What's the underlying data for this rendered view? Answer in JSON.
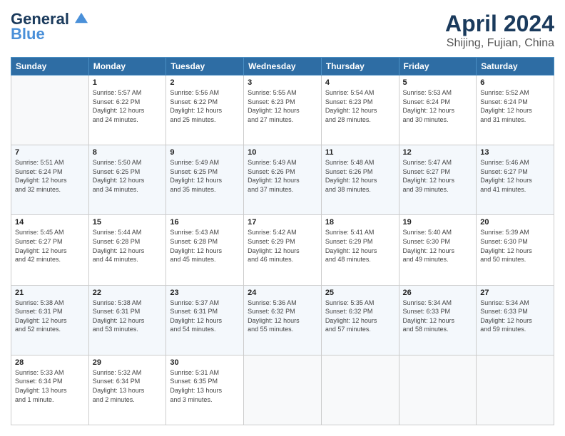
{
  "header": {
    "logo_line1": "General",
    "logo_line2": "Blue",
    "month": "April 2024",
    "location": "Shijing, Fujian, China"
  },
  "weekdays": [
    "Sunday",
    "Monday",
    "Tuesday",
    "Wednesday",
    "Thursday",
    "Friday",
    "Saturday"
  ],
  "weeks": [
    [
      {
        "day": "",
        "info": ""
      },
      {
        "day": "1",
        "info": "Sunrise: 5:57 AM\nSunset: 6:22 PM\nDaylight: 12 hours\nand 24 minutes."
      },
      {
        "day": "2",
        "info": "Sunrise: 5:56 AM\nSunset: 6:22 PM\nDaylight: 12 hours\nand 25 minutes."
      },
      {
        "day": "3",
        "info": "Sunrise: 5:55 AM\nSunset: 6:23 PM\nDaylight: 12 hours\nand 27 minutes."
      },
      {
        "day": "4",
        "info": "Sunrise: 5:54 AM\nSunset: 6:23 PM\nDaylight: 12 hours\nand 28 minutes."
      },
      {
        "day": "5",
        "info": "Sunrise: 5:53 AM\nSunset: 6:24 PM\nDaylight: 12 hours\nand 30 minutes."
      },
      {
        "day": "6",
        "info": "Sunrise: 5:52 AM\nSunset: 6:24 PM\nDaylight: 12 hours\nand 31 minutes."
      }
    ],
    [
      {
        "day": "7",
        "info": "Sunrise: 5:51 AM\nSunset: 6:24 PM\nDaylight: 12 hours\nand 32 minutes."
      },
      {
        "day": "8",
        "info": "Sunrise: 5:50 AM\nSunset: 6:25 PM\nDaylight: 12 hours\nand 34 minutes."
      },
      {
        "day": "9",
        "info": "Sunrise: 5:49 AM\nSunset: 6:25 PM\nDaylight: 12 hours\nand 35 minutes."
      },
      {
        "day": "10",
        "info": "Sunrise: 5:49 AM\nSunset: 6:26 PM\nDaylight: 12 hours\nand 37 minutes."
      },
      {
        "day": "11",
        "info": "Sunrise: 5:48 AM\nSunset: 6:26 PM\nDaylight: 12 hours\nand 38 minutes."
      },
      {
        "day": "12",
        "info": "Sunrise: 5:47 AM\nSunset: 6:27 PM\nDaylight: 12 hours\nand 39 minutes."
      },
      {
        "day": "13",
        "info": "Sunrise: 5:46 AM\nSunset: 6:27 PM\nDaylight: 12 hours\nand 41 minutes."
      }
    ],
    [
      {
        "day": "14",
        "info": "Sunrise: 5:45 AM\nSunset: 6:27 PM\nDaylight: 12 hours\nand 42 minutes."
      },
      {
        "day": "15",
        "info": "Sunrise: 5:44 AM\nSunset: 6:28 PM\nDaylight: 12 hours\nand 44 minutes."
      },
      {
        "day": "16",
        "info": "Sunrise: 5:43 AM\nSunset: 6:28 PM\nDaylight: 12 hours\nand 45 minutes."
      },
      {
        "day": "17",
        "info": "Sunrise: 5:42 AM\nSunset: 6:29 PM\nDaylight: 12 hours\nand 46 minutes."
      },
      {
        "day": "18",
        "info": "Sunrise: 5:41 AM\nSunset: 6:29 PM\nDaylight: 12 hours\nand 48 minutes."
      },
      {
        "day": "19",
        "info": "Sunrise: 5:40 AM\nSunset: 6:30 PM\nDaylight: 12 hours\nand 49 minutes."
      },
      {
        "day": "20",
        "info": "Sunrise: 5:39 AM\nSunset: 6:30 PM\nDaylight: 12 hours\nand 50 minutes."
      }
    ],
    [
      {
        "day": "21",
        "info": "Sunrise: 5:38 AM\nSunset: 6:31 PM\nDaylight: 12 hours\nand 52 minutes."
      },
      {
        "day": "22",
        "info": "Sunrise: 5:38 AM\nSunset: 6:31 PM\nDaylight: 12 hours\nand 53 minutes."
      },
      {
        "day": "23",
        "info": "Sunrise: 5:37 AM\nSunset: 6:31 PM\nDaylight: 12 hours\nand 54 minutes."
      },
      {
        "day": "24",
        "info": "Sunrise: 5:36 AM\nSunset: 6:32 PM\nDaylight: 12 hours\nand 55 minutes."
      },
      {
        "day": "25",
        "info": "Sunrise: 5:35 AM\nSunset: 6:32 PM\nDaylight: 12 hours\nand 57 minutes."
      },
      {
        "day": "26",
        "info": "Sunrise: 5:34 AM\nSunset: 6:33 PM\nDaylight: 12 hours\nand 58 minutes."
      },
      {
        "day": "27",
        "info": "Sunrise: 5:34 AM\nSunset: 6:33 PM\nDaylight: 12 hours\nand 59 minutes."
      }
    ],
    [
      {
        "day": "28",
        "info": "Sunrise: 5:33 AM\nSunset: 6:34 PM\nDaylight: 13 hours\nand 1 minute."
      },
      {
        "day": "29",
        "info": "Sunrise: 5:32 AM\nSunset: 6:34 PM\nDaylight: 13 hours\nand 2 minutes."
      },
      {
        "day": "30",
        "info": "Sunrise: 5:31 AM\nSunset: 6:35 PM\nDaylight: 13 hours\nand 3 minutes."
      },
      {
        "day": "",
        "info": ""
      },
      {
        "day": "",
        "info": ""
      },
      {
        "day": "",
        "info": ""
      },
      {
        "day": "",
        "info": ""
      }
    ]
  ]
}
